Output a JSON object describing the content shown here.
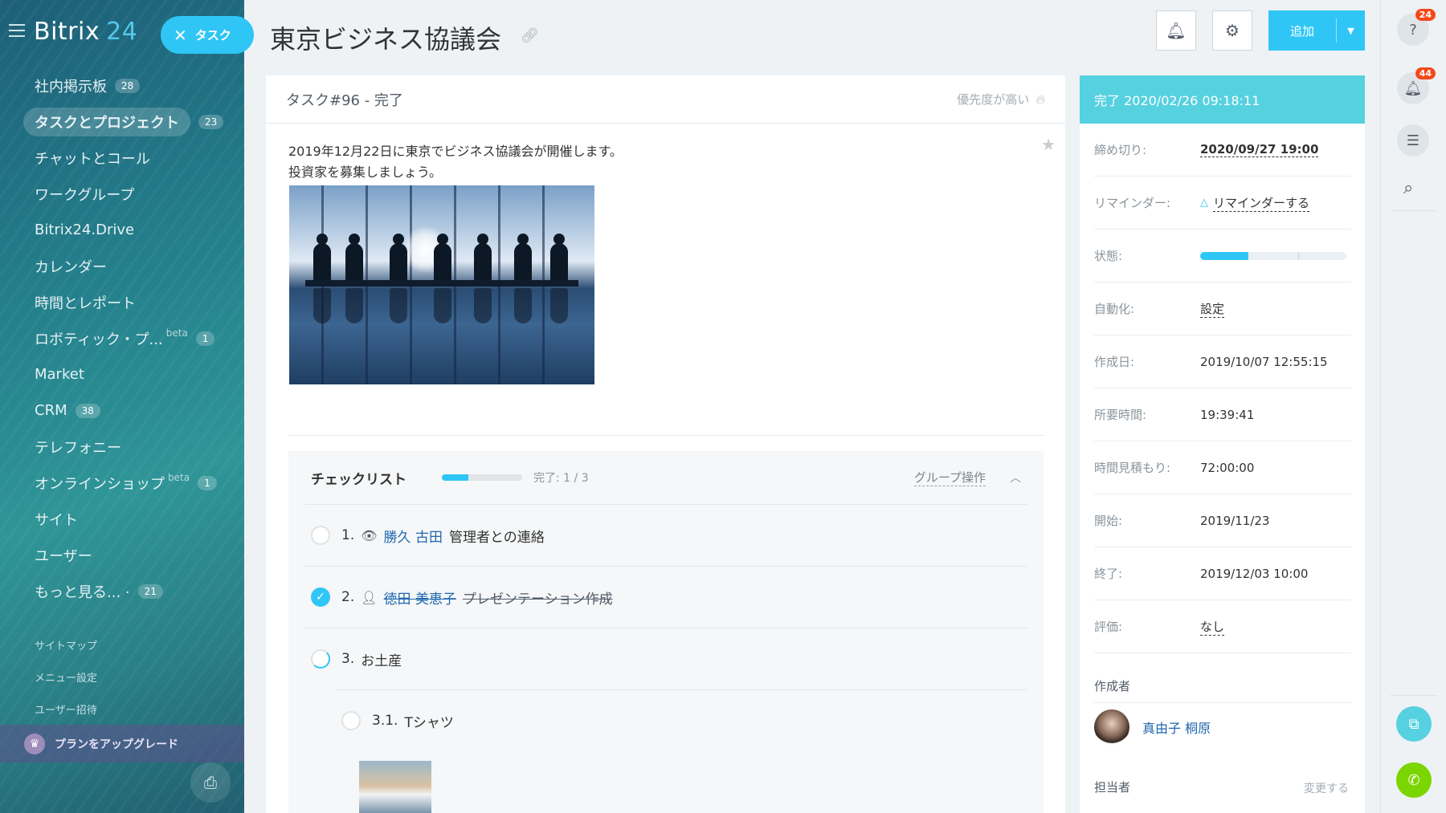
{
  "sidebar": {
    "logo_text": "Bitrix",
    "logo_num": "24",
    "task_pill": "タスク",
    "items": [
      {
        "label": "社内掲示板",
        "badge": "28"
      },
      {
        "label": "タスクとプロジェクト",
        "badge": "23"
      },
      {
        "label": "チャットとコール",
        "badge": ""
      },
      {
        "label": "ワークグループ",
        "badge": ""
      },
      {
        "label": "Bitrix24.Drive",
        "badge": ""
      },
      {
        "label": "カレンダー",
        "badge": ""
      },
      {
        "label": "時間とレポート",
        "badge": ""
      },
      {
        "label": "ロボティック・プ...",
        "badge": "1",
        "beta": "beta"
      },
      {
        "label": "Market",
        "badge": ""
      },
      {
        "label": "CRM",
        "badge": "38"
      },
      {
        "label": "テレフォニー",
        "badge": ""
      },
      {
        "label": "オンラインショップ",
        "badge": "1",
        "beta": "beta"
      },
      {
        "label": "サイト",
        "badge": ""
      },
      {
        "label": "ユーザー",
        "badge": ""
      },
      {
        "label": "もっと見る... ·",
        "badge": "21"
      }
    ],
    "small_links": [
      "サイトマップ",
      "メニュー設定",
      "ユーザー招待"
    ],
    "upgrade": "プランをアップグレード"
  },
  "header": {
    "title": "東京ビジネス協議会",
    "add_label": "追加"
  },
  "task": {
    "title": "タスク#96 - 完了",
    "priority": "優先度が高い",
    "desc_line1": "2019年12月22日に東京でビジネス協議会が開催します。",
    "desc_line2": "投資家を募集しましょう。"
  },
  "checklist": {
    "title": "チェックリスト",
    "progress": 0.33,
    "count": "完了: 1 / 3",
    "group_action": "グループ操作",
    "items": [
      {
        "num": "1.",
        "user": "勝久 古田",
        "text": "管理者との連絡"
      },
      {
        "num": "2.",
        "user": "徳田 美恵子",
        "text": "プレゼンテーション作成"
      },
      {
        "num": "3.",
        "user": "",
        "text": "お土産"
      },
      {
        "num": "3.1.",
        "user": "",
        "text": "Tシャツ"
      }
    ]
  },
  "panel": {
    "status_head": "完了 2020/02/26 09:18:11",
    "rows": [
      {
        "k": "締め切り:",
        "v": "2020/09/27 19:00"
      },
      {
        "k": "リマインダー:",
        "v": "リマインダーする"
      },
      {
        "k": "状態:",
        "v": ""
      },
      {
        "k": "自動化:",
        "v": "設定"
      },
      {
        "k": "作成日:",
        "v": "2019/10/07 12:55:15"
      },
      {
        "k": "所要時間:",
        "v": "19:39:41"
      },
      {
        "k": "時間見積もり:",
        "v": "72:00:00"
      },
      {
        "k": "開始:",
        "v": "2019/11/23"
      },
      {
        "k": "終了:",
        "v": "2019/12/03 10:00"
      },
      {
        "k": "評価:",
        "v": "なし"
      }
    ],
    "status_progress": 0.33,
    "creator_label": "作成者",
    "creator_name": "真由子 桐原",
    "assignee_label": "担当者",
    "change": "変更する"
  },
  "rightbar": {
    "help_badge": "24",
    "notif_badge": "44"
  }
}
